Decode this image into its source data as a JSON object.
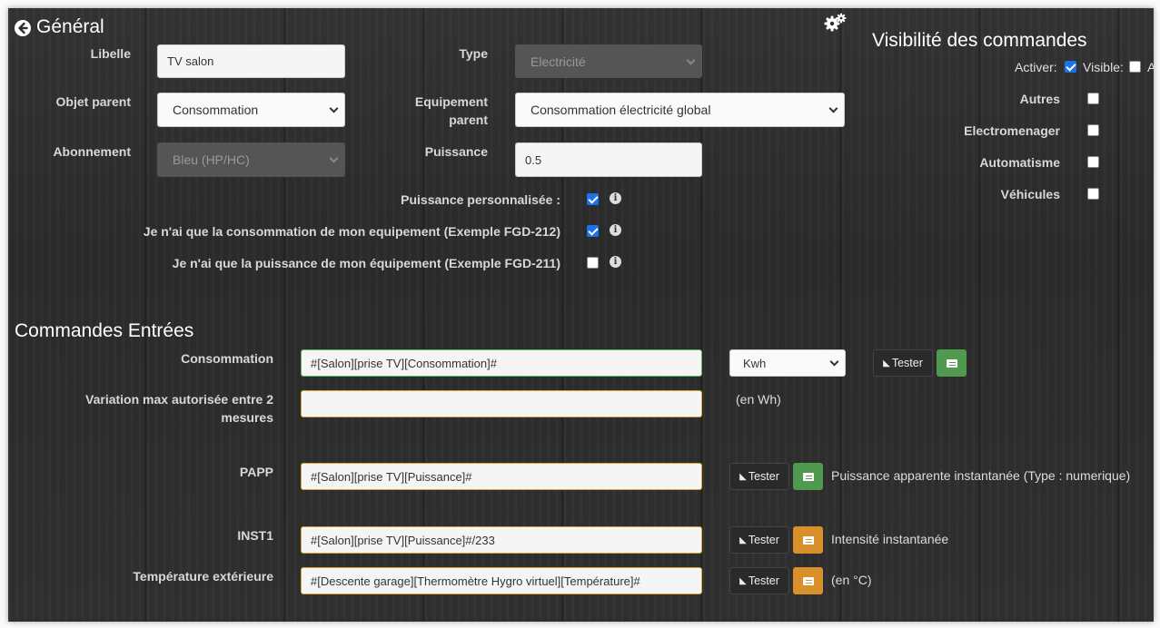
{
  "general": {
    "title": "Général",
    "fields": {
      "libelle": {
        "label": "Libelle",
        "value": "TV salon"
      },
      "type": {
        "label": "Type",
        "value": "Electricité"
      },
      "objet_parent": {
        "label": "Objet parent",
        "value": "Consommation"
      },
      "equipement_parent": {
        "label_line1": "Equipement",
        "label_line2": "parent",
        "value": "Consommation électricité global"
      },
      "abonnement": {
        "label": "Abonnement",
        "value": "Bleu (HP/HC)"
      },
      "puissance": {
        "label": "Puissance",
        "value": "0.5"
      }
    },
    "options": [
      {
        "label": "Puissance personnalisée :",
        "checked": true
      },
      {
        "label": "Je n'ai que la consommation de mon equipement (Exemple FGD-212)",
        "checked": true
      },
      {
        "label": "Je n'ai que la puissance de mon équipement (Exemple FGD-211)",
        "checked": false
      }
    ]
  },
  "visibility": {
    "title": "Visibilité des commandes",
    "activer_label": "Activer:",
    "activer_checked": true,
    "visible_label": "Visible:",
    "visible_checked": false,
    "cut_label": "A",
    "items": [
      {
        "label": "Autres",
        "checked": false
      },
      {
        "label": "Electromenager",
        "checked": false
      },
      {
        "label": "Automatisme",
        "checked": false
      },
      {
        "label": "Véhicules",
        "checked": false
      }
    ]
  },
  "commandes": {
    "title": "Commandes Entrées",
    "test_label": "Tester",
    "consommation": {
      "label": "Consommation",
      "value": "#[Salon][prise TV][Consommation]#",
      "unit": "Kwh"
    },
    "variation": {
      "label_line1": "Variation max autorisée entre 2",
      "label_line2": "mesures",
      "value": "",
      "note": "(en Wh)"
    },
    "papp": {
      "label": "PAPP",
      "value": "#[Salon][prise TV][Puissance]#",
      "note": "Puissance apparente instantanée (Type : numerique)"
    },
    "inst1": {
      "label": "INST1",
      "value": "#[Salon][prise TV][Puissance]#/233",
      "note": "Intensité instantanée"
    },
    "temperature": {
      "label": "Température extérieure",
      "value": "#[Descente garage][Thermomètre Hygro virtuel][Température]#",
      "note": "(en °C)"
    }
  },
  "colors": {
    "accent_blue": "#1a73e8",
    "btn_green": "#4f9a4f",
    "btn_orange": "#d9902a",
    "amber_border": "#e0a13a"
  }
}
